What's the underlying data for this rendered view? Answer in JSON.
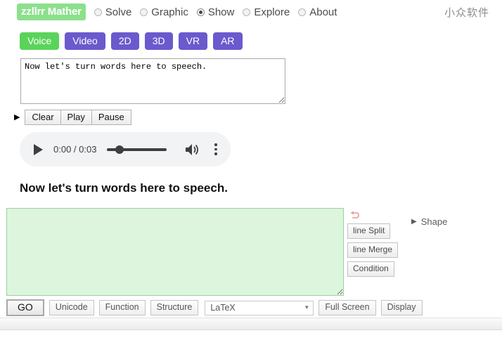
{
  "topbar": {
    "logo": "zzllrr Mather",
    "brand_cn": "小众软件",
    "radios": [
      {
        "label": "Solve",
        "checked": false
      },
      {
        "label": "Graphic",
        "checked": false
      },
      {
        "label": "Show",
        "checked": true
      },
      {
        "label": "Explore",
        "checked": false
      },
      {
        "label": "About",
        "checked": false
      }
    ]
  },
  "modebar": {
    "buttons": [
      {
        "label": "Voice",
        "active": true
      },
      {
        "label": "Video",
        "active": false
      },
      {
        "label": "2D",
        "active": false
      },
      {
        "label": "3D",
        "active": false
      },
      {
        "label": "VR",
        "active": false
      },
      {
        "label": "AR",
        "active": false
      }
    ]
  },
  "speech": {
    "input_value": "Now let's turn words here to speech.",
    "input_placeholder": "",
    "caret": "▶",
    "controls": [
      {
        "label": "Clear"
      },
      {
        "label": "Play"
      },
      {
        "label": "Pause"
      }
    ],
    "heading": "Now let's turn words here to speech."
  },
  "audio": {
    "time": "0:00 / 0:03",
    "current_time": "0:00",
    "duration": "0:03",
    "progress_percent": 14,
    "play_icon": "play-icon",
    "volume_icon": "volume-icon",
    "menu_icon": "kebab-menu-icon"
  },
  "editor": {
    "value": "",
    "placeholder": "",
    "background_color": "#ddf5dd",
    "border_color": "#9cd29c"
  },
  "side_tools": {
    "undo_icon": "undo-icon",
    "buttons": [
      {
        "label": "line Split"
      },
      {
        "label": "line Merge"
      },
      {
        "label": "Condition"
      }
    ]
  },
  "shape": {
    "caret": "▶",
    "label": "Shape"
  },
  "bottombar": {
    "go_label": "GO",
    "buttons": [
      {
        "label": "Unicode"
      },
      {
        "label": "Function"
      },
      {
        "label": "Structure"
      }
    ],
    "format_selected": "LaTeX",
    "format_options": [
      "LaTeX"
    ],
    "chevron": "▼",
    "right_buttons": [
      {
        "label": "Full Screen"
      },
      {
        "label": "Display"
      }
    ]
  },
  "colors": {
    "brand_green": "#8ce08c",
    "mode_purple": "#6a5acd",
    "active_green": "#5bd35b",
    "editor_green": "#ddf5dd",
    "player_gray": "#f1f3f4"
  }
}
